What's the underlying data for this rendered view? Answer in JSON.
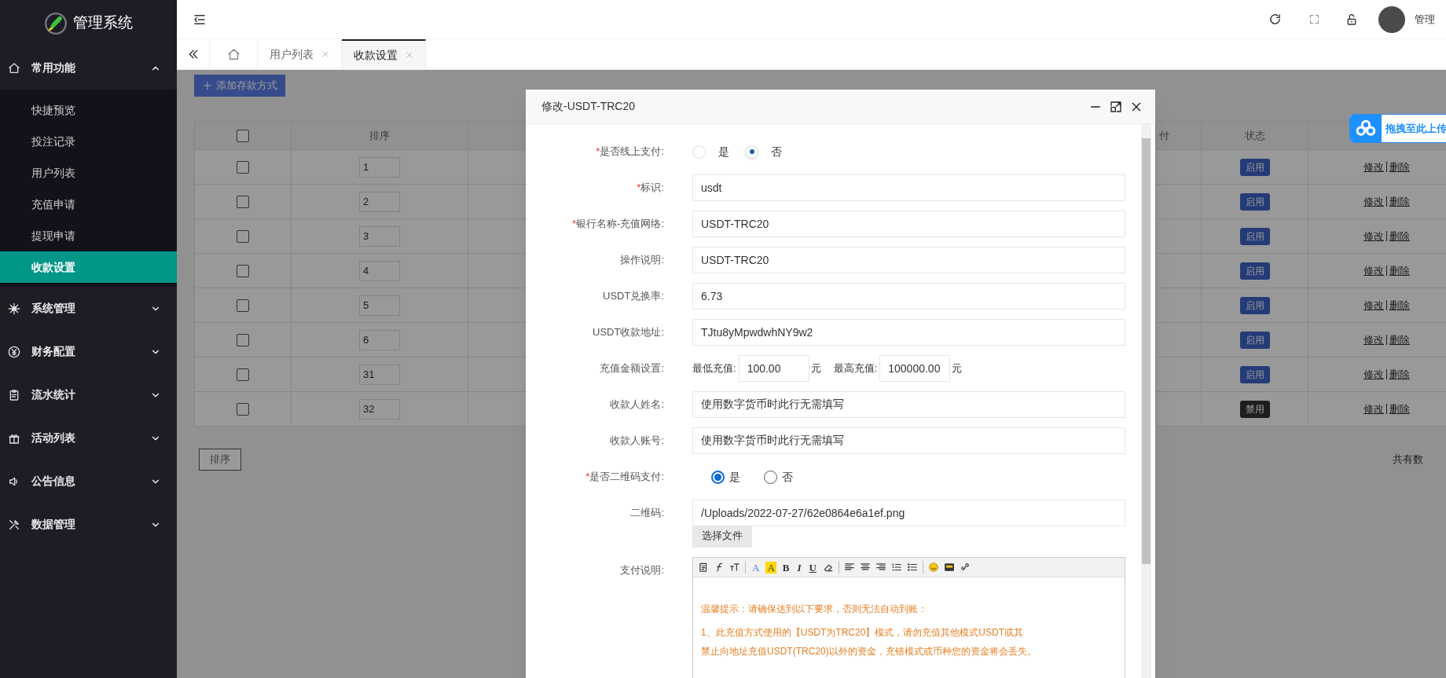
{
  "sidebar": {
    "logo_text": "管理系统",
    "menus": [
      {
        "label": "常用功能",
        "expanded": true,
        "children": [
          {
            "label": "快捷预览",
            "selected": false
          },
          {
            "label": "投注记录",
            "selected": false
          },
          {
            "label": "用户列表",
            "selected": false
          },
          {
            "label": "充值申请",
            "selected": false
          },
          {
            "label": "提现申请",
            "selected": false
          },
          {
            "label": "收款设置",
            "selected": true
          }
        ]
      },
      {
        "label": "系统管理",
        "expanded": false
      },
      {
        "label": "财务配置",
        "expanded": false
      },
      {
        "label": "流水统计",
        "expanded": false
      },
      {
        "label": "活动列表",
        "expanded": false
      },
      {
        "label": "公告信息",
        "expanded": false
      },
      {
        "label": "数据管理",
        "expanded": false
      }
    ]
  },
  "header": {
    "user_name": "管理"
  },
  "tabs": [
    {
      "label": "用户列表",
      "selected": false
    },
    {
      "label": "收款设置",
      "selected": true
    }
  ],
  "toolbar": {
    "add_button": "添加存款方式"
  },
  "table": {
    "select_all_checked": false,
    "columns": {
      "sort": "排序",
      "column_3": "付",
      "status": "状态"
    },
    "rows": [
      {
        "checked": false,
        "sort": "1",
        "status": "启用",
        "enabled": true,
        "actions": [
          "修改",
          "删除"
        ]
      },
      {
        "checked": false,
        "sort": "2",
        "status": "启用",
        "enabled": true,
        "actions": [
          "修改",
          "删除"
        ]
      },
      {
        "checked": false,
        "sort": "3",
        "status": "启用",
        "enabled": true,
        "actions": [
          "修改",
          "删除"
        ]
      },
      {
        "checked": false,
        "sort": "4",
        "status": "启用",
        "enabled": true,
        "actions": [
          "修改",
          "删除"
        ]
      },
      {
        "checked": false,
        "sort": "5",
        "status": "启用",
        "enabled": true,
        "actions": [
          "修改",
          "删除"
        ]
      },
      {
        "checked": false,
        "sort": "6",
        "status": "启用",
        "enabled": true,
        "actions": [
          "修改",
          "删除"
        ]
      },
      {
        "checked": false,
        "sort": "31",
        "status": "启用",
        "enabled": true,
        "actions": [
          "修改",
          "删除"
        ]
      },
      {
        "checked": false,
        "sort": "32",
        "status": "禁用",
        "enabled": false,
        "actions": [
          "修改",
          "删除"
        ]
      }
    ]
  },
  "sort_button": "排序",
  "footer_text": "共有数",
  "upload_widget": {
    "label": "拖拽至此上传"
  },
  "dialog": {
    "title": "修改-USDT-TRC20",
    "fields": [
      {
        "kind": "toggle-radio",
        "asterisk": "*",
        "label": "是否线上支付:",
        "options": [
          {
            "label": "是",
            "selected": false
          },
          {
            "label": "否",
            "selected": true
          }
        ]
      },
      {
        "kind": "text",
        "asterisk": "*",
        "label": "标识:",
        "value": "usdt"
      },
      {
        "kind": "text",
        "asterisk": "*",
        "label": "银行名称-充值网络:",
        "value": "USDT-TRC20"
      },
      {
        "kind": "text",
        "label": "操作说明:",
        "value": "USDT-TRC20"
      },
      {
        "kind": "text",
        "label": "USDT兑换率:",
        "value": "6.73"
      },
      {
        "kind": "text",
        "label": "USDT收款地址:",
        "value": "TJtu8yMpwdwhNY9w2"
      },
      {
        "kind": "range",
        "label": "充值金额设置:",
        "min_label": "最低充值:",
        "min_value": "100.00",
        "max_label": "最高充值:",
        "max_value": "100000.00",
        "min_unit": "元",
        "max_unit": "元"
      },
      {
        "kind": "text",
        "label": "收款人姓名:",
        "value": "使用数字货币时此行无需填写"
      },
      {
        "kind": "text",
        "label": "收款人账号:",
        "value": "使用数字货币时此行无需填写"
      },
      {
        "kind": "radio",
        "asterisk": "*",
        "label": "是否二维码支付:",
        "options": [
          {
            "label": "是",
            "selected": true
          },
          {
            "label": "否",
            "selected": false
          }
        ]
      },
      {
        "kind": "file",
        "label": "二维码:",
        "value": "/Uploads/2022-07-27/62e0864e6a1ef.png",
        "button": "选择文件"
      },
      {
        "kind": "editor",
        "label": "支付说明:",
        "toolbar": [
          {
            "kind": "paste"
          },
          {
            "kind": "font"
          },
          {
            "kind": "size"
          },
          {
            "kind": "separator"
          },
          {
            "kind": "color",
            "glyph": "A"
          },
          {
            "kind": "highlight",
            "glyph": "A"
          },
          {
            "kind": "bold",
            "glyph": "B"
          },
          {
            "kind": "italic",
            "glyph": "I"
          },
          {
            "kind": "underline",
            "glyph": "U"
          },
          {
            "kind": "eraser"
          },
          {
            "kind": "separator"
          },
          {
            "kind": "align-left"
          },
          {
            "kind": "align-center"
          },
          {
            "kind": "align-right"
          },
          {
            "kind": "ordered-list"
          },
          {
            "kind": "bullet-list"
          },
          {
            "kind": "separator"
          },
          {
            "kind": "emoji"
          },
          {
            "kind": "image"
          },
          {
            "kind": "link"
          }
        ],
        "lines": [
          "温馨提示：请确保达到以下要求，否则无法自动到账：",
          "1、此充值方式使用的【USDT为TRC20】模式，请勿充值其他模式USDT或其",
          "禁止向地址充值USDT(TRC20)以外的资金，充错模式或币种您的资金将会丢失。"
        ]
      }
    ]
  }
}
